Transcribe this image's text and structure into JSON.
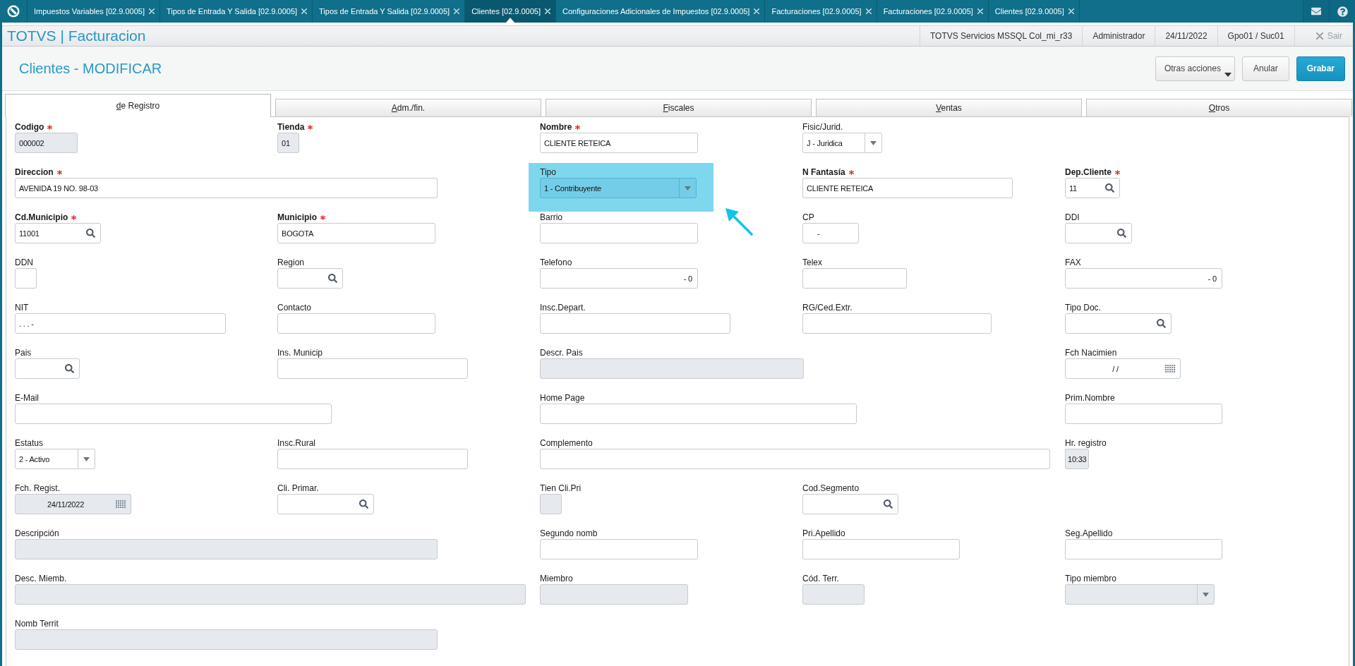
{
  "tab_bar": {
    "tabs": [
      {
        "label": "Impuestos Variables [02.9.0005]",
        "selected": false
      },
      {
        "label": "Tipos de Entrada Y Salida [02.9.0005]",
        "selected": false
      },
      {
        "label": "Tipos de Entrada Y Salida [02.9.0005]",
        "selected": false
      },
      {
        "label": "Clientes [02.9.0005]",
        "selected": true
      },
      {
        "label": "Configuraciones Adicionales de Impuestos [02.9.0005]",
        "selected": false
      },
      {
        "label": "Facturaciones [02.9.0005]",
        "selected": false
      },
      {
        "label": "Facturaciones [02.9.0005]",
        "selected": false
      },
      {
        "label": "Clientes [02.9.0005]",
        "selected": false
      }
    ]
  },
  "title_bar": {
    "title": "TOTVS | Facturacion",
    "info": [
      "TOTVS Servicios MSSQL Col_mi_r33",
      "Administrador",
      "24/11/2022",
      "Gpo01 / Suc01"
    ],
    "exit": {
      "label": "Sair",
      "disabled": true
    }
  },
  "header": {
    "title": "Clientes - MODIFICAR",
    "buttons": [
      {
        "label": "Otras acciones",
        "kind": "menu"
      },
      {
        "label": "Anular",
        "kind": "default"
      },
      {
        "label": "Grabar",
        "kind": "primary"
      }
    ]
  },
  "form_tabs": [
    {
      "label": "de Registro",
      "selected": true
    },
    {
      "label": "Adm./fin.",
      "selected": false
    },
    {
      "label": "Fiscales",
      "selected": false
    },
    {
      "label": "Ventas",
      "selected": false
    },
    {
      "label": "Otros",
      "selected": false
    }
  ],
  "form": {
    "rows": [
      [
        {
          "label": "Codigo",
          "kind": "text",
          "required": true,
          "disabled": true,
          "highlighted": false,
          "value": "000002"
        },
        {
          "label": "Tienda",
          "kind": "text",
          "required": true,
          "disabled": true,
          "highlighted": false,
          "value": "01"
        },
        {
          "label": "Nombre",
          "kind": "text",
          "required": true,
          "disabled": false,
          "highlighted": false,
          "value": "CLIENTE RETEICA"
        },
        {
          "label": "Fisic/Jurid.",
          "kind": "select",
          "required": false,
          "disabled": false,
          "highlighted": false,
          "value": "J - Juridica"
        }
      ],
      [
        {
          "label": "Direccion",
          "kind": "text",
          "required": true,
          "disabled": false,
          "highlighted": false,
          "value": "AVENIDA 19 NO. 98-03"
        },
        "",
        {
          "label": "Tipo",
          "kind": "select",
          "required": false,
          "disabled": false,
          "highlighted": true,
          "value": "1 - Contribuyente"
        },
        {
          "label": "N Fantasía",
          "kind": "text",
          "required": true,
          "disabled": false,
          "highlighted": false,
          "value": "CLIENTE RETEICA"
        },
        {
          "label": "Dep.Cliente",
          "kind": "lookup",
          "required": true,
          "disabled": false,
          "highlighted": false,
          "value": "11"
        }
      ],
      [
        {
          "label": "Cd.Municipio",
          "kind": "lookup",
          "required": true,
          "disabled": false,
          "highlighted": false,
          "value": "11001"
        },
        {
          "label": "Municipio",
          "kind": "text",
          "required": true,
          "disabled": false,
          "highlighted": false,
          "value": "BOGOTA"
        },
        {
          "label": "Barrio",
          "kind": "text",
          "required": false,
          "disabled": false,
          "highlighted": false
        },
        {
          "label": "CP",
          "kind": "text",
          "required": false,
          "disabled": false,
          "highlighted": false,
          "value": "-"
        },
        {
          "label": "DDI",
          "kind": "lookup",
          "required": false,
          "disabled": false,
          "highlighted": false
        }
      ],
      [
        {
          "label": "DDN",
          "kind": "text",
          "required": false,
          "disabled": false,
          "highlighted": false
        },
        {
          "label": "Region",
          "kind": "lookup",
          "required": false,
          "disabled": false,
          "highlighted": false
        },
        {
          "label": "Telefono",
          "kind": "text",
          "required": false,
          "disabled": false,
          "highlighted": false,
          "value": "- 0"
        },
        {
          "label": "Telex",
          "kind": "text",
          "required": false,
          "disabled": false,
          "highlighted": false
        },
        {
          "label": "FAX",
          "kind": "text",
          "required": false,
          "disabled": false,
          "highlighted": false,
          "value": "- 0"
        }
      ],
      [
        {
          "label": "NIT",
          "kind": "text",
          "required": false,
          "disabled": false,
          "highlighted": false,
          "value": ". . . -"
        },
        {
          "label": "Contacto",
          "kind": "text",
          "required": false,
          "disabled": false,
          "highlighted": false
        },
        {
          "label": "Insc.Depart.",
          "kind": "text",
          "required": false,
          "disabled": false,
          "highlighted": false
        },
        {
          "label": "RG/Ced.Extr.",
          "kind": "text",
          "required": false,
          "disabled": false,
          "highlighted": false
        },
        {
          "label": "Tipo Doc.",
          "kind": "lookup",
          "required": false,
          "disabled": false,
          "highlighted": false
        }
      ],
      [
        {
          "label": "Pais",
          "kind": "lookup",
          "required": false,
          "disabled": false,
          "highlighted": false
        },
        {
          "label": "Ins. Municip",
          "kind": "text",
          "required": false,
          "disabled": false,
          "highlighted": false
        },
        {
          "label": "Descr. Pais",
          "kind": "text",
          "required": false,
          "disabled": true,
          "highlighted": false
        },
        "",
        {
          "label": "Fch Nacimien",
          "kind": "date",
          "required": false,
          "disabled": false,
          "highlighted": false,
          "value": "/ /"
        }
      ],
      [
        {
          "label": "E-Mail",
          "kind": "text",
          "required": false,
          "disabled": false,
          "highlighted": false
        },
        "",
        {
          "label": "Home Page",
          "kind": "text",
          "required": false,
          "disabled": false,
          "highlighted": false
        },
        "",
        {
          "label": "Prim.Nombre",
          "kind": "text",
          "required": false,
          "disabled": false,
          "highlighted": false
        }
      ],
      [
        {
          "label": "Estatus",
          "kind": "select",
          "required": false,
          "disabled": false,
          "highlighted": false,
          "value": "2 - Activo"
        },
        {
          "label": "Insc.Rural",
          "kind": "text",
          "required": false,
          "disabled": false,
          "highlighted": false
        },
        {
          "label": "Complemento",
          "kind": "text",
          "required": false,
          "disabled": false,
          "highlighted": false
        },
        "",
        {
          "label": "Hr. registro",
          "kind": "text",
          "required": false,
          "disabled": true,
          "highlighted": false,
          "value": "10:33"
        }
      ],
      [
        {
          "label": "Fch. Regist.",
          "kind": "date",
          "required": false,
          "disabled": true,
          "highlighted": false,
          "value": "24/11/2022"
        },
        {
          "label": "Cli. Primar.",
          "kind": "lookup",
          "required": false,
          "disabled": false,
          "highlighted": false
        },
        {
          "label": "Tien Cli.Pri",
          "kind": "text",
          "required": false,
          "disabled": true,
          "highlighted": false
        },
        {
          "label": "Cod.Segmento",
          "kind": "lookup",
          "required": false,
          "disabled": false,
          "highlighted": false
        }
      ],
      [
        {
          "label": "Descripción",
          "kind": "text",
          "required": false,
          "disabled": true,
          "highlighted": false
        },
        "",
        {
          "label": "Segundo nomb",
          "kind": "text",
          "required": false,
          "disabled": false,
          "highlighted": false
        },
        {
          "label": "Pri.Apellido",
          "kind": "text",
          "required": false,
          "disabled": false,
          "highlighted": false
        },
        {
          "label": "Seg.Apellido",
          "kind": "text",
          "required": false,
          "disabled": false,
          "highlighted": false
        }
      ],
      [
        {
          "label": "Desc. Miemb.",
          "kind": "text",
          "required": false,
          "disabled": true,
          "highlighted": false
        },
        "",
        {
          "label": "Miembro",
          "kind": "text",
          "required": false,
          "disabled": true,
          "highlighted": false
        },
        {
          "label": "Cód. Terr.",
          "kind": "text",
          "required": false,
          "disabled": true,
          "highlighted": false
        },
        {
          "label": "Tipo miembro",
          "kind": "select",
          "required": false,
          "disabled": true,
          "highlighted": false
        }
      ],
      [
        {
          "label": "Nomb Territ",
          "kind": "text",
          "required": false,
          "disabled": true,
          "highlighted": false
        }
      ]
    ]
  }
}
